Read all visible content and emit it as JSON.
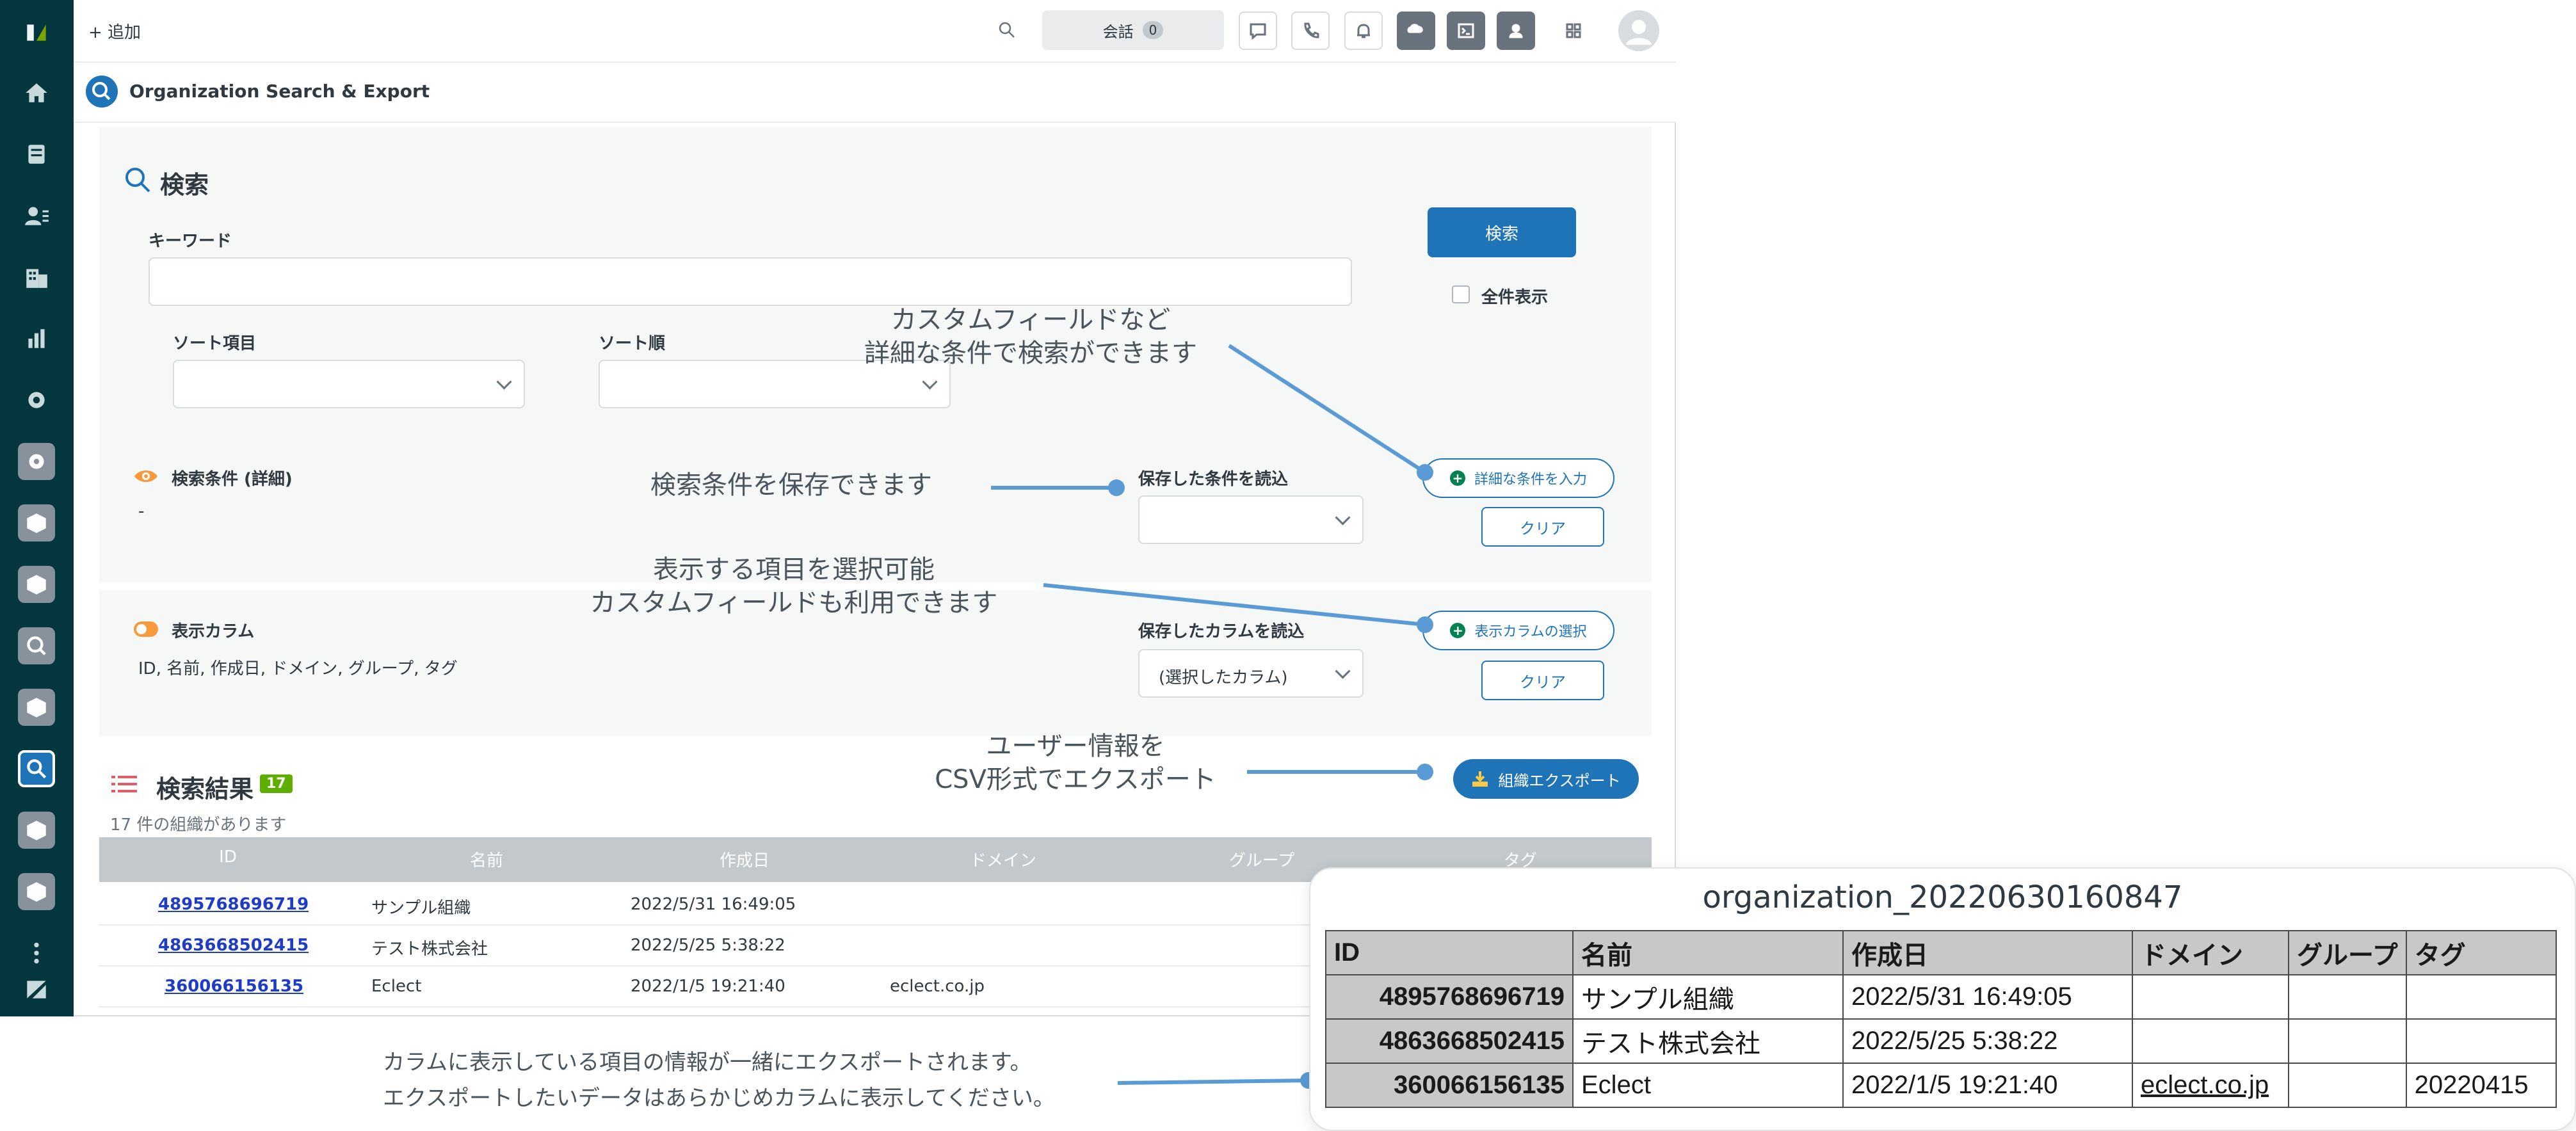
{
  "topbar": {
    "add_label": "+ 追加",
    "conversations_label": "会話",
    "conversations_count": "0"
  },
  "app": {
    "title": "Organization Search & Export"
  },
  "search": {
    "heading": "検索",
    "keyword_label": "キーワード",
    "keyword_value": "",
    "sort_field_label": "ソート項目",
    "sort_field_value": "",
    "sort_order_label": "ソート順",
    "sort_order_value": "",
    "search_button": "検索",
    "show_all_label": "全件表示",
    "show_all_checked": false,
    "conditions_label": "検索条件 (詳細)",
    "conditions_value": "-",
    "saved_conditions_label": "保存した条件を読込",
    "saved_conditions_value": "",
    "advanced_button": "詳細な条件を入力",
    "clear_button": "クリア"
  },
  "columns": {
    "label": "表示カラム",
    "value": "ID, 名前, 作成日, ドメイン, グループ, タグ",
    "saved_columns_label": "保存したカラムを読込",
    "saved_columns_value": "(選択したカラム)",
    "select_button": "表示カラムの選択",
    "clear_button": "クリア"
  },
  "results": {
    "heading": "検索結果",
    "count_badge": "17",
    "summary": "17 件の組織があります",
    "export_button": "組織エクスポート",
    "headers": [
      "ID",
      "名前",
      "作成日",
      "ドメイン",
      "グループ",
      "タグ"
    ],
    "rows": [
      {
        "id": "4895768696719",
        "name": "サンプル組織",
        "created": "2022/5/31 16:49:05",
        "domain": ""
      },
      {
        "id": "4863668502415",
        "name": "テスト株式会社",
        "created": "2022/5/25 5:38:22",
        "domain": ""
      },
      {
        "id": "360066156135",
        "name": "Eclect",
        "created": "2022/1/5 19:21:40",
        "domain": "eclect.co.jp"
      }
    ]
  },
  "annotations": {
    "advanced_line1": "カスタムフィールドなど",
    "advanced_line2": "詳細な条件で検索ができます",
    "save_conditions": "検索条件を保存できます",
    "columns_line1": "表示する項目を選択可能",
    "columns_line2": "カスタムフィールドも利用できます",
    "export_line1": "ユーザー情報を",
    "export_line2": "CSV形式でエクスポート",
    "note_line1": "カラムに表示している項目の情報が一緒にエクスポートされます。",
    "note_line2": "エクスポートしたいデータはあらかじめカラムに表示してください。",
    "line_color": "#5a9bd5"
  },
  "export_preview": {
    "filename": "organization_20220630160847",
    "headers": [
      "ID",
      "名前",
      "作成日",
      "ドメイン",
      "グループ",
      "タグ"
    ],
    "rows": [
      {
        "id": "4895768696719",
        "name": "サンプル組織",
        "created": "2022/5/31 16:49:05",
        "domain": "",
        "group": "",
        "tag": ""
      },
      {
        "id": "4863668502415",
        "name": "テスト株式会社",
        "created": "2022/5/25 5:38:22",
        "domain": "",
        "group": "",
        "tag": ""
      },
      {
        "id": "360066156135",
        "name": "Eclect",
        "created": "2022/1/5 19:21:40",
        "domain": "eclect.co.jp",
        "group": "",
        "tag": "20220415"
      }
    ]
  },
  "colors": {
    "sidebar": "#03363d",
    "primary": "#1f73b7",
    "badge_green": "#5eae00",
    "eye_orange": "#f79a3e"
  }
}
